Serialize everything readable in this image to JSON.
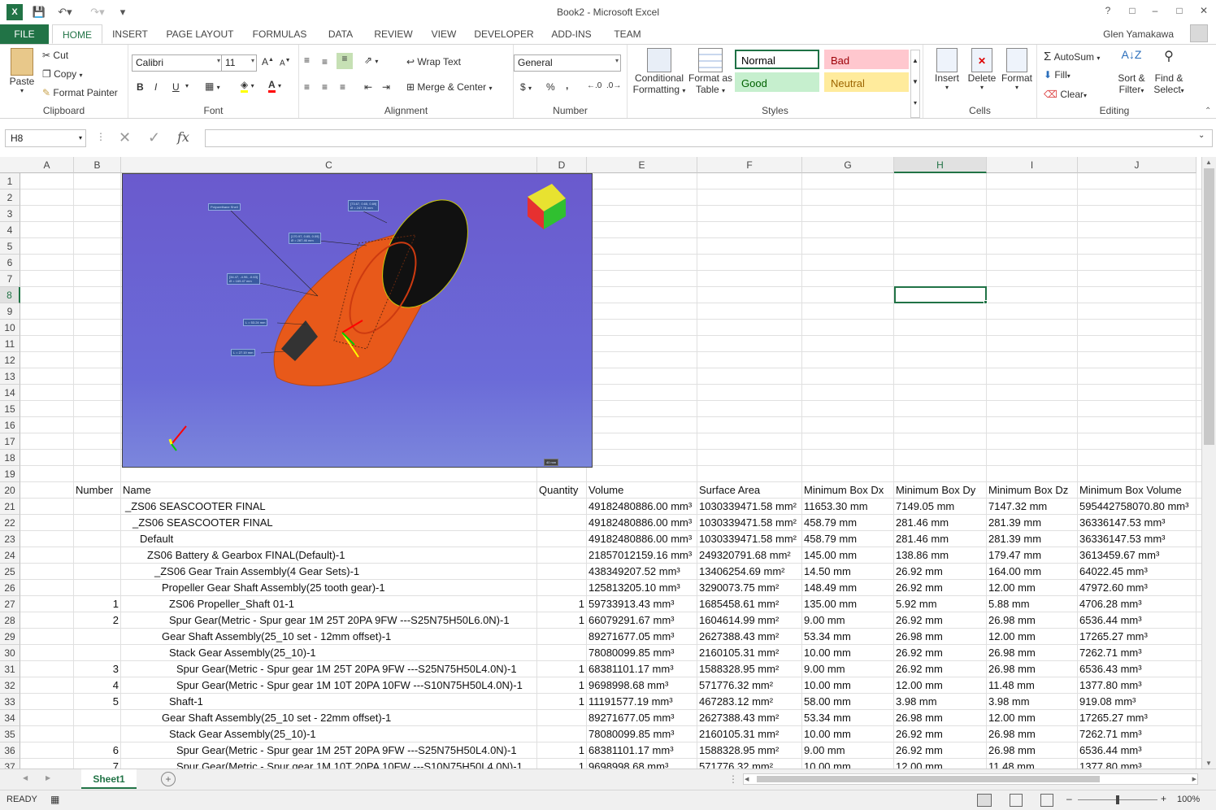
{
  "window": {
    "title": "Book2 - Microsoft Excel",
    "help": "?",
    "controls": [
      "□",
      "–",
      "□",
      "✕"
    ]
  },
  "tabs": {
    "file": "FILE",
    "items": [
      "HOME",
      "INSERT",
      "PAGE LAYOUT",
      "FORMULAS",
      "DATA",
      "REVIEW",
      "VIEW",
      "DEVELOPER",
      "ADD-INS",
      "TEAM"
    ],
    "active": "HOME",
    "user": "Glen Yamakawa"
  },
  "ribbon": {
    "clipboard": {
      "label": "Clipboard",
      "paste": "Paste",
      "cut": "Cut",
      "copy": "Copy",
      "format_painter": "Format Painter"
    },
    "font": {
      "label": "Font",
      "name": "Calibri",
      "size": "11",
      "bold": "B",
      "italic": "I",
      "underline": "U"
    },
    "alignment": {
      "label": "Alignment",
      "wrap": "Wrap Text",
      "merge": "Merge & Center"
    },
    "number": {
      "label": "Number",
      "format": "General",
      "currency": "$",
      "percent": "%",
      "comma": ","
    },
    "styles": {
      "label": "Styles",
      "conditional": [
        "Conditional",
        "Formatting"
      ],
      "format_table": [
        "Format as",
        "Table"
      ],
      "cells": [
        {
          "name": "Normal",
          "bg": "#ffffff",
          "fg": "#000000",
          "border": "#1e7145"
        },
        {
          "name": "Bad",
          "bg": "#ffc7ce",
          "fg": "#9c0006",
          "border": "#ffc7ce"
        },
        {
          "name": "Good",
          "bg": "#c6efce",
          "fg": "#006100",
          "border": "#c6efce"
        },
        {
          "name": "Neutral",
          "bg": "#ffeb9c",
          "fg": "#9c6500",
          "border": "#ffeb9c"
        }
      ]
    },
    "cells": {
      "label": "Cells",
      "insert": "Insert",
      "delete": "Delete",
      "format": "Format"
    },
    "editing": {
      "label": "Editing",
      "autosum": "AutoSum",
      "fill": "Fill",
      "clear": "Clear",
      "sort": [
        "Sort &",
        "Filter"
      ],
      "find": [
        "Find &",
        "Select"
      ]
    }
  },
  "formula_bar": {
    "namebox": "H8",
    "fx": "fx",
    "formula": ""
  },
  "grid": {
    "columns": [
      "A",
      "B",
      "C",
      "D",
      "E",
      "F",
      "G",
      "H",
      "I",
      "J"
    ],
    "selected_column": "H",
    "selected_row": "8",
    "rows": [
      "1",
      "2",
      "3",
      "4",
      "5",
      "6",
      "7",
      "8",
      "9",
      "10",
      "11",
      "12",
      "13",
      "14",
      "15",
      "16",
      "17",
      "18",
      "19",
      "20",
      "21",
      "22",
      "23",
      "24",
      "25",
      "26",
      "27",
      "28",
      "29",
      "30",
      "31",
      "32",
      "33",
      "34",
      "35",
      "36",
      "37"
    ],
    "header": [
      "Number",
      "Name",
      "Quantity",
      "Volume",
      "Surface Area",
      "Minimum Box Dx",
      "Minimum Box Dy",
      "Minimum Box Dz",
      "Minimum Box Volume"
    ],
    "data": [
      {
        "num": "",
        "name": "_ZS06 SEASCOOTER FINAL",
        "indent": 0,
        "qty": "",
        "vol": "49182480886.00 mm³",
        "area": "1030339471.58 mm²",
        "dx": "11653.30 mm",
        "dy": "7149.05 mm",
        "dz": "7147.32 mm",
        "bv": "595442758070.80 mm³"
      },
      {
        "num": "",
        "name": "_ZS06 SEASCOOTER FINAL",
        "indent": 1,
        "qty": "",
        "vol": "49182480886.00 mm³",
        "area": "1030339471.58 mm²",
        "dx": "458.79 mm",
        "dy": "281.46 mm",
        "dz": "281.39 mm",
        "bv": "36336147.53 mm³"
      },
      {
        "num": "",
        "name": "Default",
        "indent": 2,
        "qty": "",
        "vol": "49182480886.00 mm³",
        "area": "1030339471.58 mm²",
        "dx": "458.79 mm",
        "dy": "281.46 mm",
        "dz": "281.39 mm",
        "bv": "36336147.53 mm³"
      },
      {
        "num": "",
        "name": "ZS06 Battery & Gearbox FINAL(Default)-1",
        "indent": 3,
        "qty": "",
        "vol": "21857012159.16 mm³",
        "area": "249320791.68 mm²",
        "dx": "145.00 mm",
        "dy": "138.86 mm",
        "dz": "179.47 mm",
        "bv": "3613459.67 mm³"
      },
      {
        "num": "",
        "name": "_ZS06 Gear Train Assembly(4 Gear Sets)-1",
        "indent": 4,
        "qty": "",
        "vol": "438349207.52 mm³",
        "area": "13406254.69 mm²",
        "dx": "14.50 mm",
        "dy": "26.92 mm",
        "dz": "164.00 mm",
        "bv": "64022.45 mm³"
      },
      {
        "num": "",
        "name": "Propeller Gear Shaft Assembly(25 tooth gear)-1",
        "indent": 5,
        "qty": "",
        "vol": "125813205.10 mm³",
        "area": "3290073.75 mm²",
        "dx": "148.49 mm",
        "dy": "26.92 mm",
        "dz": "12.00 mm",
        "bv": "47972.60 mm³"
      },
      {
        "num": "1",
        "name": "ZS06 Propeller_Shaft 01-1",
        "indent": 6,
        "qty": "1",
        "vol": "59733913.43 mm³",
        "area": "1685458.61 mm²",
        "dx": "135.00 mm",
        "dy": "5.92 mm",
        "dz": "5.88 mm",
        "bv": "4706.28 mm³"
      },
      {
        "num": "2",
        "name": "Spur Gear(Metric - Spur gear 1M 25T 20PA 9FW ---S25N75H50L6.0N)-1",
        "indent": 6,
        "qty": "1",
        "vol": "66079291.67 mm³",
        "area": "1604614.99 mm²",
        "dx": "9.00 mm",
        "dy": "26.92 mm",
        "dz": "26.98 mm",
        "bv": "6536.44 mm³"
      },
      {
        "num": "",
        "name": "Gear Shaft Assembly(25_10 set - 12mm offset)-1",
        "indent": 5,
        "qty": "",
        "vol": "89271677.05 mm³",
        "area": "2627388.43 mm²",
        "dx": "53.34 mm",
        "dy": "26.98 mm",
        "dz": "12.00 mm",
        "bv": "17265.27 mm³"
      },
      {
        "num": "",
        "name": "Stack Gear Assembly(25_10)-1",
        "indent": 6,
        "qty": "",
        "vol": "78080099.85 mm³",
        "area": "2160105.31 mm²",
        "dx": "10.00 mm",
        "dy": "26.92 mm",
        "dz": "26.98 mm",
        "bv": "7262.71 mm³"
      },
      {
        "num": "3",
        "name": "Spur Gear(Metric - Spur gear 1M 25T 20PA 9FW ---S25N75H50L4.0N)-1",
        "indent": 7,
        "qty": "1",
        "vol": "68381101.17 mm³",
        "area": "1588328.95 mm²",
        "dx": "9.00 mm",
        "dy": "26.92 mm",
        "dz": "26.98 mm",
        "bv": "6536.43 mm³"
      },
      {
        "num": "4",
        "name": "Spur Gear(Metric - Spur gear 1M 10T 20PA 10FW ---S10N75H50L4.0N)-1",
        "indent": 7,
        "qty": "1",
        "vol": "9698998.68 mm³",
        "area": "571776.32 mm²",
        "dx": "10.00 mm",
        "dy": "12.00 mm",
        "dz": "11.48 mm",
        "bv": "1377.80 mm³"
      },
      {
        "num": "5",
        "name": "Shaft-1",
        "indent": 6,
        "qty": "1",
        "vol": "11191577.19 mm³",
        "area": "467283.12 mm²",
        "dx": "58.00 mm",
        "dy": "3.98 mm",
        "dz": "3.98 mm",
        "bv": "919.08 mm³"
      },
      {
        "num": "",
        "name": "Gear Shaft Assembly(25_10 set - 22mm offset)-1",
        "indent": 5,
        "qty": "",
        "vol": "89271677.05 mm³",
        "area": "2627388.43 mm²",
        "dx": "53.34 mm",
        "dy": "26.98 mm",
        "dz": "12.00 mm",
        "bv": "17265.27 mm³"
      },
      {
        "num": "",
        "name": "Stack Gear Assembly(25_10)-1",
        "indent": 6,
        "qty": "",
        "vol": "78080099.85 mm³",
        "area": "2160105.31 mm²",
        "dx": "10.00 mm",
        "dy": "26.92 mm",
        "dz": "26.98 mm",
        "bv": "7262.71 mm³"
      },
      {
        "num": "6",
        "name": "Spur Gear(Metric - Spur gear 1M 25T 20PA 9FW ---S25N75H50L4.0N)-1",
        "indent": 7,
        "qty": "1",
        "vol": "68381101.17 mm³",
        "area": "1588328.95 mm²",
        "dx": "9.00 mm",
        "dy": "26.92 mm",
        "dz": "26.98 mm",
        "bv": "6536.44 mm³"
      },
      {
        "num": "7",
        "name": "Spur Gear(Metric - Spur gear 1M 10T 20PA 10FW ---S10N75H50L4.0N)-1",
        "indent": 7,
        "qty": "1",
        "vol": "9698998.68 mm³",
        "area": "571776.32 mm²",
        "dx": "10.00 mm",
        "dy": "12.00 mm",
        "dz": "11.48 mm",
        "bv": "1377.80 mm³"
      }
    ]
  },
  "picture": {
    "annotations": [
      "Polyurethane Shell",
      "[73.67, 0.65, 0.69]",
      "Ø = 247.76 mm",
      "[170.97, 0.65, 0.09]",
      "Ø = 287.46 mm",
      "[34.47, -4.96, -0.63]",
      "Ø = 169.47 mm",
      "L = 53.24 mm",
      "L = 27.19 mm",
      "40 mm"
    ]
  },
  "sheets": {
    "tabs": [
      "Sheet1"
    ],
    "active": "Sheet1",
    "add": "+"
  },
  "status": {
    "mode": "READY",
    "zoom": "100%",
    "zoom_level": 1.0
  }
}
